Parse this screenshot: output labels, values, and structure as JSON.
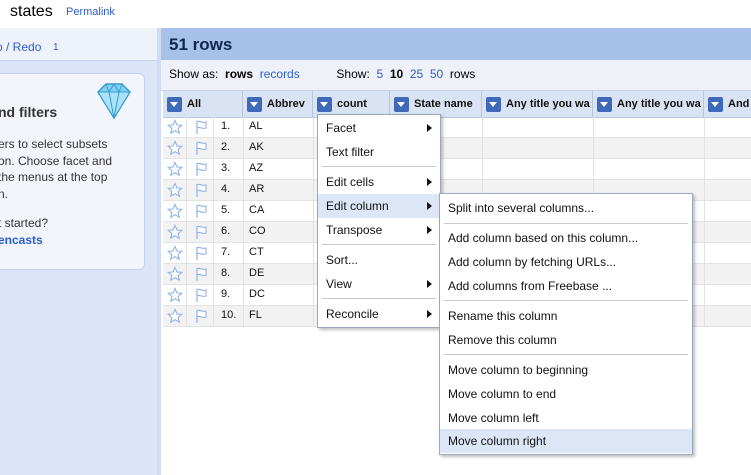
{
  "header": {
    "project_name": "states",
    "permalink": "Permalink"
  },
  "left": {
    "undo_label": "o / Redo",
    "undo_count": "1",
    "facet_title": "nd filters",
    "facet_lines": [
      "ers to select subsets",
      "on. Choose facet and",
      " the menus at the top",
      "n."
    ],
    "get_started": "t started?",
    "screencasts": "encasts"
  },
  "main": {
    "rows_title": "51 rows",
    "show_as_label": "Show as:",
    "mode_rows": "rows",
    "mode_records": "records",
    "show_label": "Show:",
    "page_sizes": [
      "5",
      "10",
      "25",
      "50"
    ],
    "page_size_selected": "10",
    "rows_suffix": "rows"
  },
  "columns": [
    "All",
    "Abbrev",
    "count",
    "State name",
    "Any title you wa",
    "Any title you wa",
    "And"
  ],
  "rows": [
    {
      "n": "1.",
      "abbrev": "AL"
    },
    {
      "n": "2.",
      "abbrev": "AK"
    },
    {
      "n": "3.",
      "abbrev": "AZ"
    },
    {
      "n": "4.",
      "abbrev": "AR"
    },
    {
      "n": "5.",
      "abbrev": "CA"
    },
    {
      "n": "6.",
      "abbrev": "CO"
    },
    {
      "n": "7.",
      "abbrev": "CT"
    },
    {
      "n": "8.",
      "abbrev": "DE"
    },
    {
      "n": "9.",
      "abbrev": "DC"
    },
    {
      "n": "10.",
      "abbrev": "FL"
    }
  ],
  "column_menu": {
    "facet": "Facet",
    "text_filter": "Text filter",
    "edit_cells": "Edit cells",
    "edit_column": "Edit column",
    "transpose": "Transpose",
    "sort": "Sort...",
    "view": "View",
    "reconcile": "Reconcile"
  },
  "edit_column_menu": {
    "split": "Split into several columns...",
    "add_based": "Add column based on this column...",
    "add_fetch": "Add column by fetching URLs...",
    "add_freebase": "Add columns from Freebase ...",
    "rename": "Rename this column",
    "remove": "Remove this column",
    "move_begin": "Move column to beginning",
    "move_end": "Move column to end",
    "move_left": "Move column left",
    "move_right": "Move column right"
  },
  "colors": {
    "header_blue": "#a8c1ea",
    "link": "#2c5dcd",
    "dropdown": "#3f6ab9",
    "highlight": "#dce6f6"
  },
  "icons": [
    "diamond-icon",
    "star-icon",
    "flag-icon",
    "dropdown-arrow-icon",
    "submenu-arrow-icon"
  ]
}
